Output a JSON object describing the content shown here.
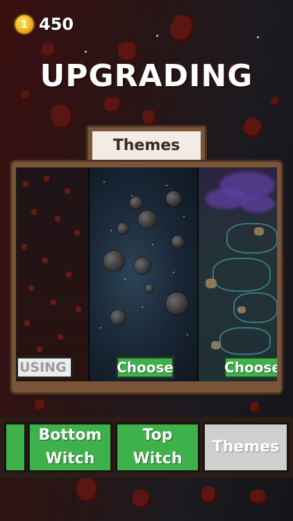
{
  "currency": {
    "icon": "gold-coin-icon",
    "count": "450"
  },
  "title": "UPGRADING",
  "section": {
    "label": "Themes"
  },
  "themes": [
    {
      "name": "red-asteroids-theme",
      "status": "USING"
    },
    {
      "name": "space-planets-theme",
      "action": "Choose"
    },
    {
      "name": "nebula-theme",
      "action": "Choose"
    }
  ],
  "tabs": [
    {
      "label": ""
    },
    {
      "label_line1": "Bottom",
      "label_line2": "Witch"
    },
    {
      "label_line1": "Top",
      "label_line2": "Witch"
    },
    {
      "label": "Themes"
    }
  ],
  "colors": {
    "accent_green": "#3fb14a",
    "frame_brown": "#7a5538",
    "disabled_grey": "#cfcfcf"
  }
}
